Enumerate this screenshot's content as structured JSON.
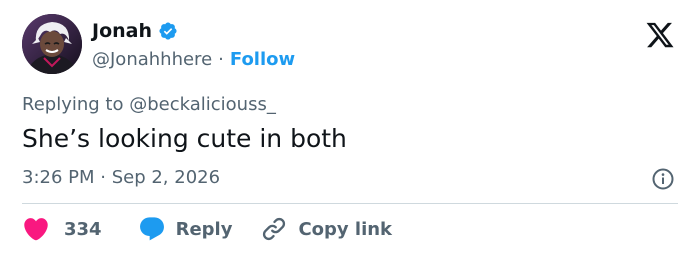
{
  "author": {
    "display_name": "Jonah",
    "handle": "@Jonahhhere",
    "separator": "·",
    "follow_label": "Follow",
    "verified_icon": "verified-badge-icon"
  },
  "replying": {
    "prefix": "Replying to",
    "mention": "@beckaliciouss_"
  },
  "tweet": {
    "text": "She’s looking cute in both",
    "timestamp": "3:26 PM · Sep 2, 2026"
  },
  "actions": {
    "like_count": "334",
    "reply_label": "Reply",
    "copy_link_label": "Copy link"
  },
  "colors": {
    "accent": "#1d9bf0",
    "like": "#f91880",
    "text_primary": "#0f1419",
    "text_secondary": "#536471",
    "divider": "#cfd9de"
  },
  "icons": {
    "brand": "x-logo-icon",
    "info": "info-icon",
    "like": "heart-icon",
    "reply": "speech-bubble-icon",
    "copy_link": "link-icon"
  }
}
